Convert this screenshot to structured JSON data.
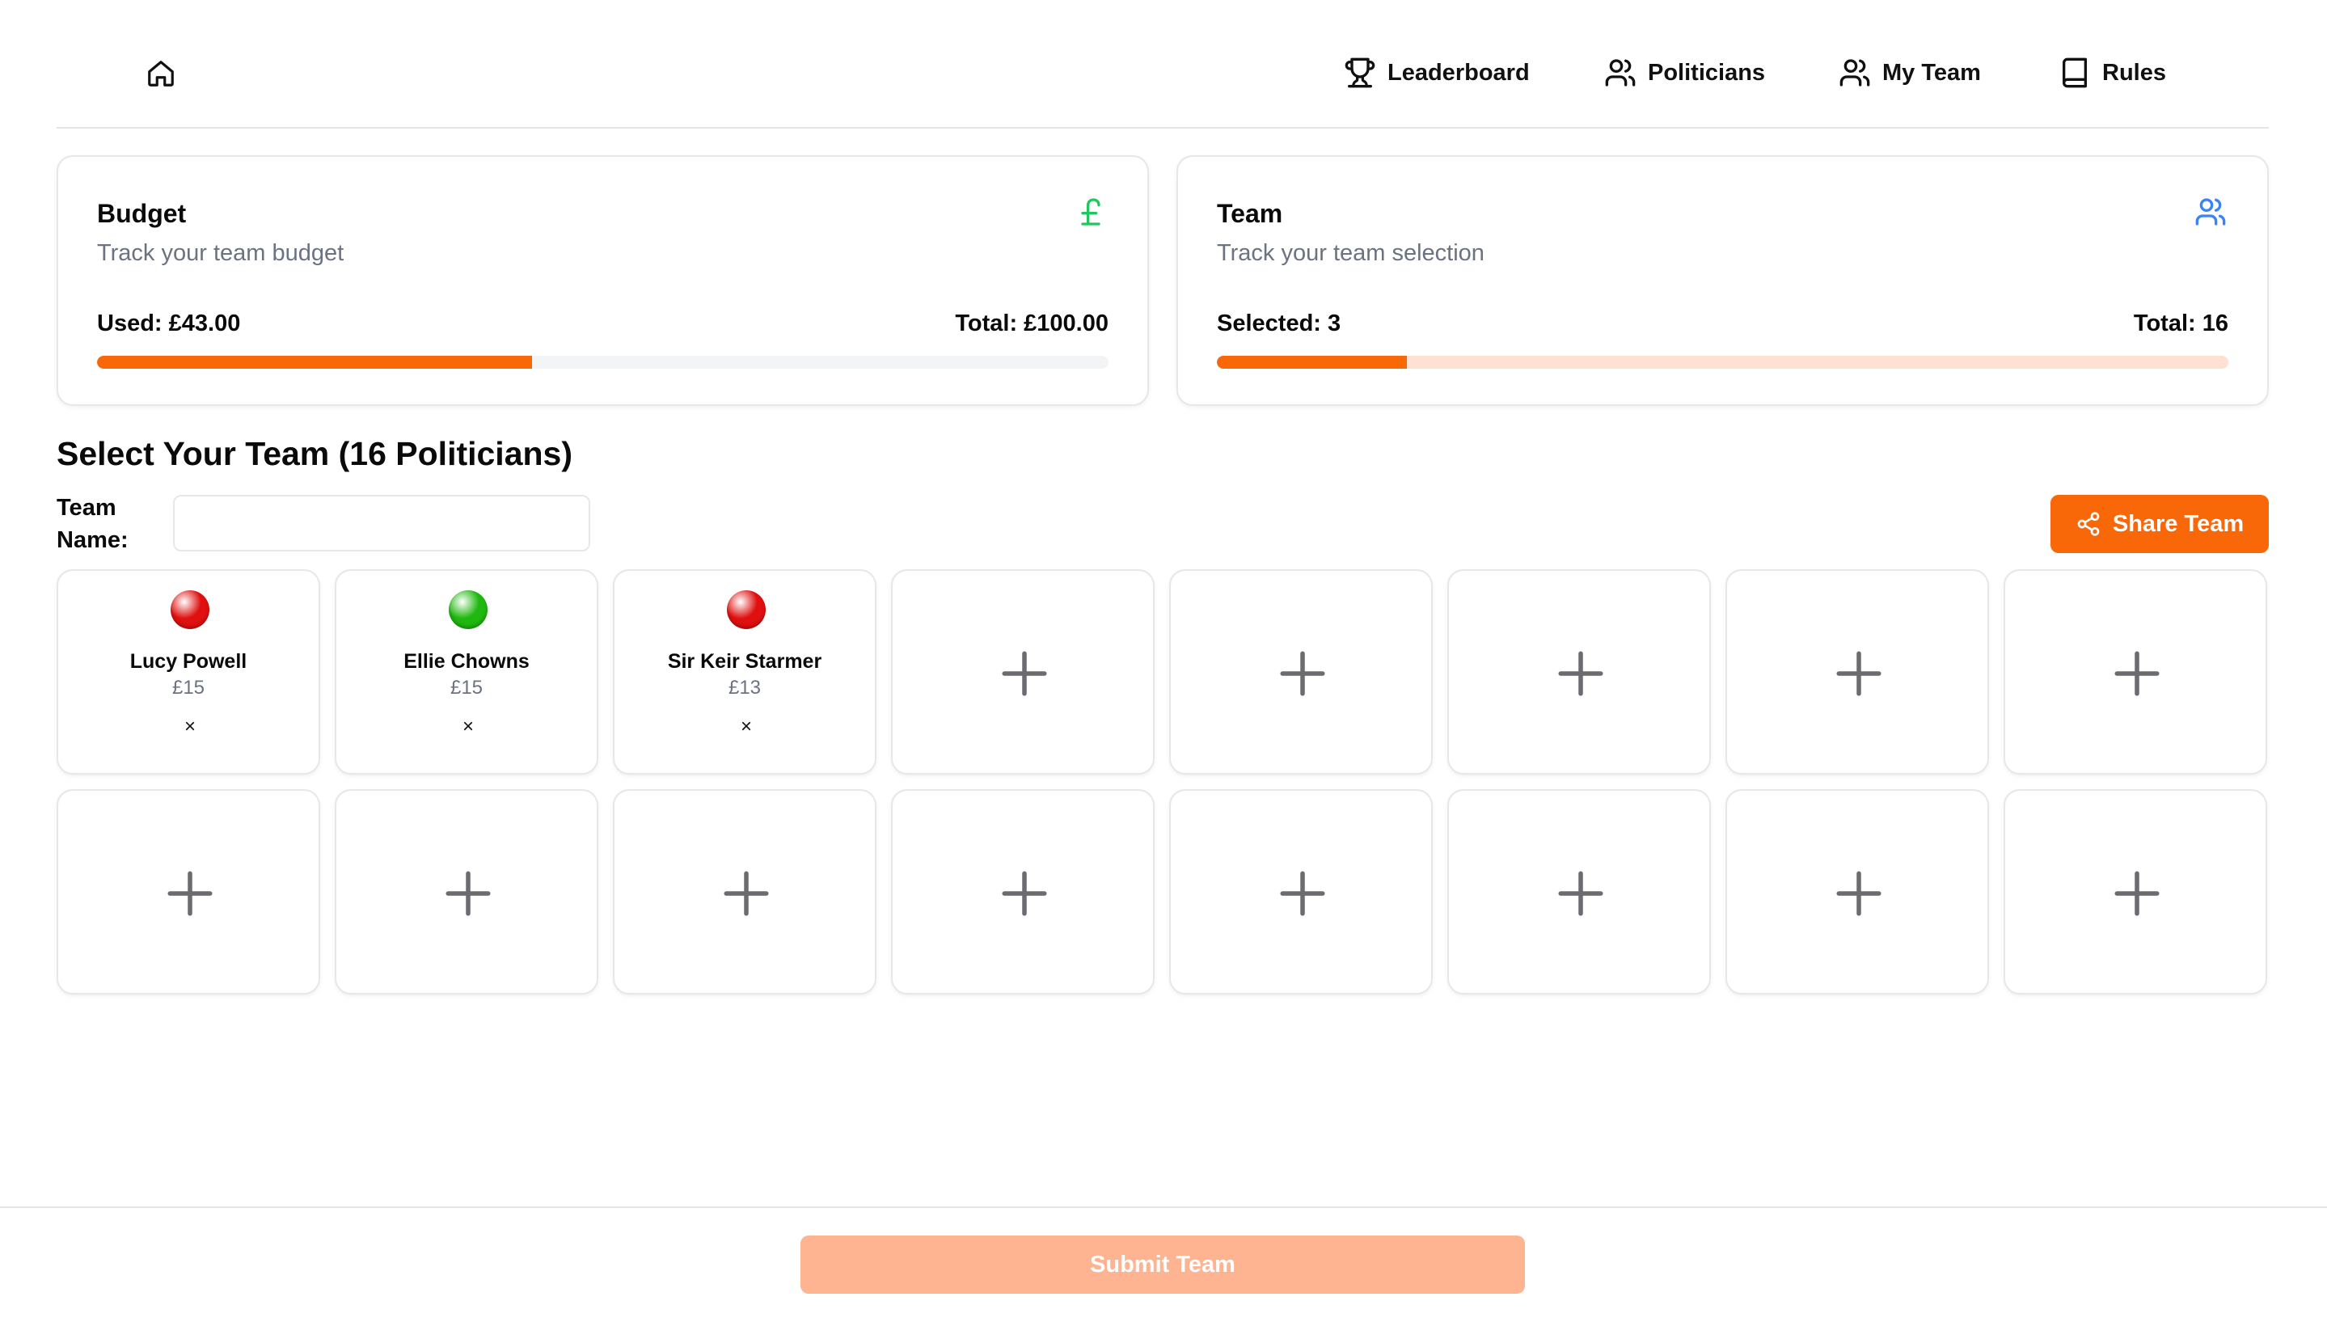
{
  "nav": {
    "home_icon": "home-icon",
    "items": [
      {
        "label": "Leaderboard",
        "icon": "trophy-icon"
      },
      {
        "label": "Politicians",
        "icon": "users-icon"
      },
      {
        "label": "My Team",
        "icon": "users-icon"
      },
      {
        "label": "Rules",
        "icon": "book-icon"
      }
    ]
  },
  "budget_card": {
    "title": "Budget",
    "subtitle": "Track your team budget",
    "icon": "pound-icon",
    "used_label": "Used: £43.00",
    "total_label": "Total: £100.00",
    "used": 43,
    "total": 100,
    "progress_fraction": 0.43
  },
  "team_card": {
    "title": "Team",
    "subtitle": "Track your team selection",
    "icon": "users-icon",
    "selected_label": "Selected: 3",
    "total_label": "Total: 16",
    "selected": 3,
    "total": 16,
    "progress_fraction": 0.1875
  },
  "section": {
    "title": "Select Your Team (16 Politicians)",
    "team_name_label": "Team Name:",
    "team_name_value": "",
    "share_label": "Share Team"
  },
  "slots": [
    {
      "name": "Lucy Powell",
      "cost": "£15",
      "party_color": "#e01010",
      "remove": "×"
    },
    {
      "name": "Ellie Chowns",
      "cost": "£15",
      "party_color": "#1fb80f",
      "remove": "×"
    },
    {
      "name": "Sir Keir Starmer",
      "cost": "£13",
      "party_color": "#e01010",
      "remove": "×"
    },
    {
      "empty": true
    },
    {
      "empty": true
    },
    {
      "empty": true
    },
    {
      "empty": true
    },
    {
      "empty": true
    },
    {
      "empty": true
    },
    {
      "empty": true
    },
    {
      "empty": true
    },
    {
      "empty": true
    },
    {
      "empty": true
    },
    {
      "empty": true
    },
    {
      "empty": true
    },
    {
      "empty": true
    }
  ],
  "footer": {
    "submit_label": "Submit Team"
  },
  "colors": {
    "accent": "#f86808",
    "submit_disabled": "#feb491",
    "budget_icon": "#22c55e",
    "team_icon": "#3b82f6",
    "budget_track": "#f3f4f6",
    "team_track": "#fee1d2"
  }
}
